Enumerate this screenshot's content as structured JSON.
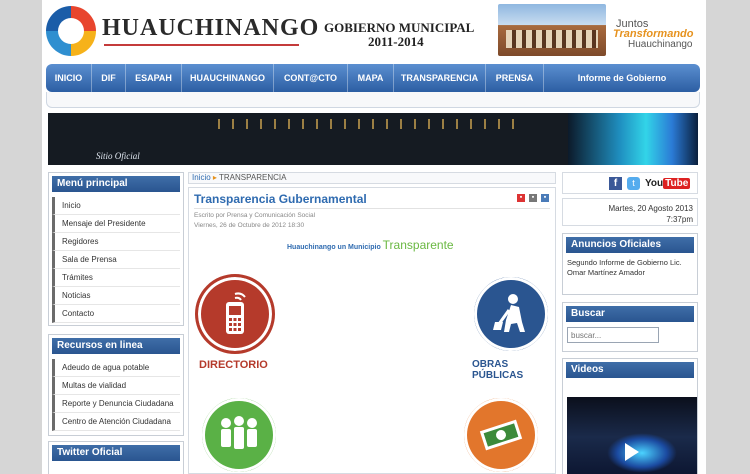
{
  "header": {
    "brand": "HUAUCHINANGO",
    "government_line1": "GOBIERNO MUNICIPAL",
    "government_line2": "2011-2014",
    "slogan_line1": "Juntos",
    "slogan_line2": "Transformando",
    "slogan_line3": "Huauchinango"
  },
  "nav": {
    "items": [
      {
        "label": "INICIO"
      },
      {
        "label": "DIF"
      },
      {
        "label": "ESAPAH"
      },
      {
        "label": "HUAUCHINANGO"
      },
      {
        "label": "CONT@CTO"
      },
      {
        "label": "MAPA"
      },
      {
        "label": "TRANSPARENCIA"
      },
      {
        "label": "PRENSA"
      },
      {
        "label": "Informe de Gobierno"
      }
    ]
  },
  "banner": {
    "text": "Sitio Oficial"
  },
  "menu_principal": {
    "title": "Menú principal",
    "items": [
      "Inicio",
      "Mensaje del Presidente",
      "Regidores",
      "Sala de Prensa",
      "Trámites",
      "Noticias",
      "Contacto"
    ]
  },
  "recursos": {
    "title": "Recursos en linea",
    "items": [
      "Adeudo de agua potable",
      "Multas de vialidad",
      "Reporte y Denuncia Ciudadana",
      "Centro de Atención Ciudadana"
    ]
  },
  "twitter": {
    "title": "Twitter Oficial"
  },
  "breadcrumb": {
    "home": "Inicio",
    "separator": "▸",
    "current": "TRANSPARENCIA"
  },
  "article": {
    "title": "Transparencia Gubernamental",
    "meta_author": "Escrito por Prensa y Comunicación Social",
    "meta_date": "Viernes, 26 de Octubre de 2012 18:30",
    "tagline_prefix": "Huauchinango un Municipio",
    "tagline_highlight": "Transparente",
    "tiles": [
      {
        "label": "DIRECTORIO",
        "icon": "phone-icon"
      },
      {
        "label": "OBRAS PÚBLICAS",
        "icon": "worker-icon"
      },
      {
        "label": "",
        "icon": "people-icon"
      },
      {
        "label": "",
        "icon": "money-icon"
      }
    ]
  },
  "social": {
    "facebook": "f",
    "twitter": "t",
    "youtube_you": "You",
    "youtube_tube": "Tube"
  },
  "date": {
    "line1": "Martes, 20 Agosto 2013",
    "line2": "7:37pm"
  },
  "anuncios": {
    "title": "Anuncios Oficiales",
    "text": "Segundo Informe de Gobierno Lic. Omar Martínez Amador"
  },
  "buscar": {
    "title": "Buscar",
    "placeholder": "buscar..."
  },
  "videos": {
    "title": "Videos"
  }
}
